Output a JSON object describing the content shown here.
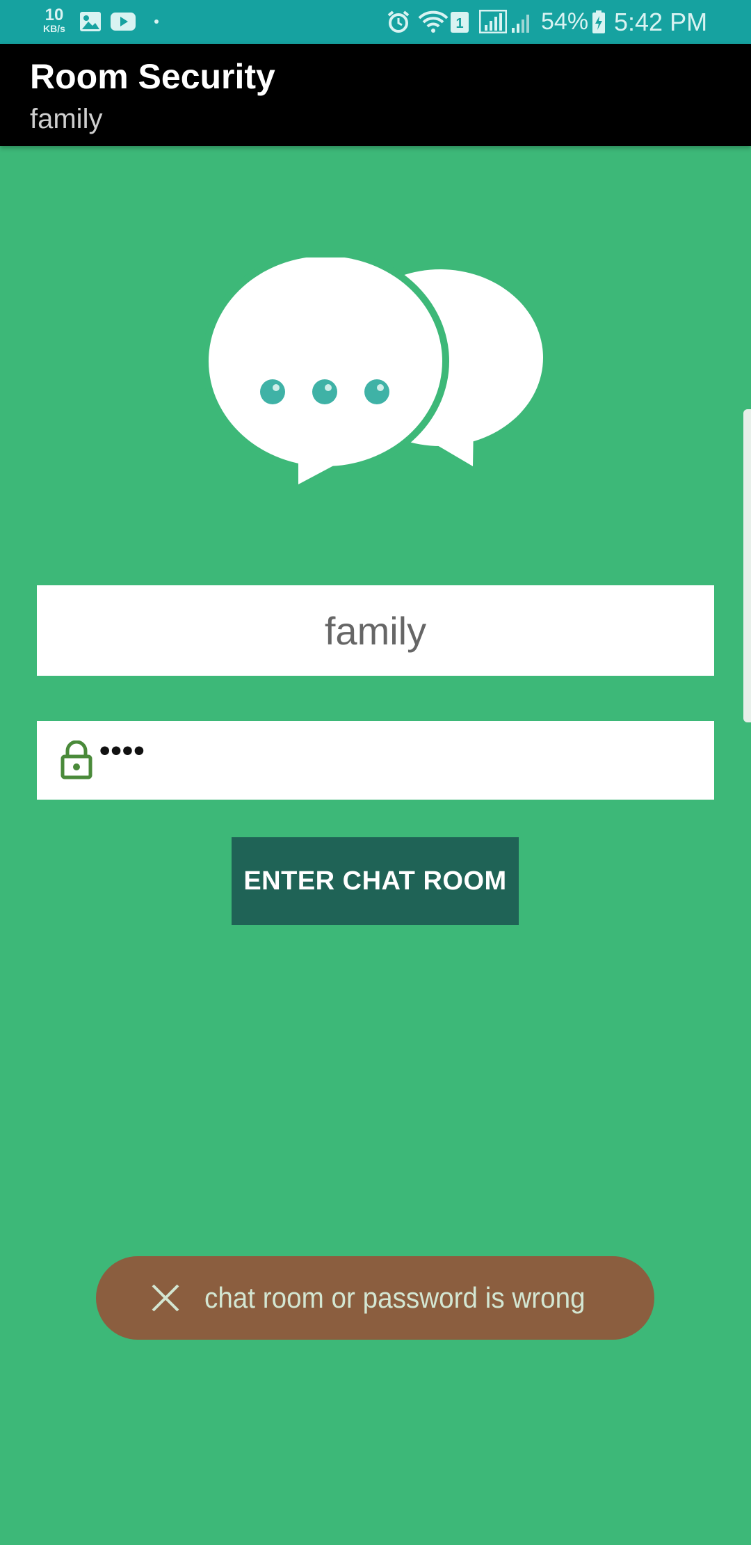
{
  "status_bar": {
    "net_speed_value": "10",
    "net_speed_unit": "KB/s",
    "icons": [
      "image-icon",
      "youtube-icon",
      "dot-icon",
      "alarm-icon",
      "wifi-icon",
      "sim-1-icon",
      "signal-icon",
      "signal-weak-icon",
      "battery-icon"
    ],
    "sim_label": "1",
    "battery_percent": "54%",
    "time": "5:42 PM"
  },
  "app_bar": {
    "title": "Room Security",
    "subtitle": "family"
  },
  "logo": {
    "icon": "chat-bubbles-icon"
  },
  "form": {
    "room_name": "family",
    "password_mask": "••••",
    "lock_icon": "lock-icon",
    "enter_button_label": "ENTER CHAT ROOM"
  },
  "toast": {
    "icon": "close-icon",
    "message": "chat room or password is wrong"
  },
  "colors": {
    "status_bar": "#16a2a0",
    "background": "#3db878",
    "app_bar": "#000000",
    "button": "#1f6356",
    "toast": "#8b5e3f",
    "dots": "#3fb2a6",
    "lock": "#4a8a3a"
  }
}
